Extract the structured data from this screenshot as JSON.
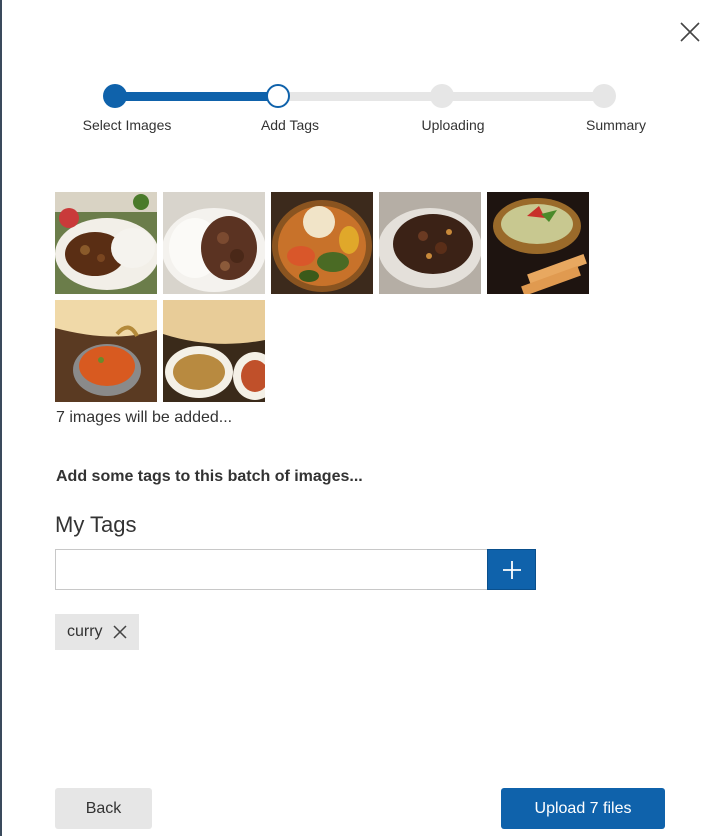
{
  "dialog": {
    "close_icon": "close-icon"
  },
  "stepper": {
    "steps": [
      {
        "label": "Select Images",
        "state": "done"
      },
      {
        "label": "Add Tags",
        "state": "current"
      },
      {
        "label": "Uploading",
        "state": "pending"
      },
      {
        "label": "Summary",
        "state": "pending"
      }
    ],
    "colors": {
      "done": "#0f62ab",
      "pending": "#e6e6e6"
    }
  },
  "images": {
    "thumbnails": [
      {
        "name": "curry-rice-plate"
      },
      {
        "name": "beef-curry-rice"
      },
      {
        "name": "soup-curry-vegetables"
      },
      {
        "name": "dark-curry-plate"
      },
      {
        "name": "green-curry-bowl"
      },
      {
        "name": "curry-with-naan"
      },
      {
        "name": "naan-and-curry-bowls"
      }
    ],
    "count_text": "7 images will be added..."
  },
  "tags": {
    "prompt": "Add some tags to this batch of images...",
    "section_label": "My Tags",
    "input_value": "",
    "add_icon": "plus-icon",
    "items": [
      {
        "label": "curry",
        "remove_icon": "close-icon"
      }
    ]
  },
  "footer": {
    "back_label": "Back",
    "upload_label": "Upload 7 files"
  },
  "colors": {
    "accent": "#0f62ab",
    "neutral_button": "#e6e6e6"
  }
}
